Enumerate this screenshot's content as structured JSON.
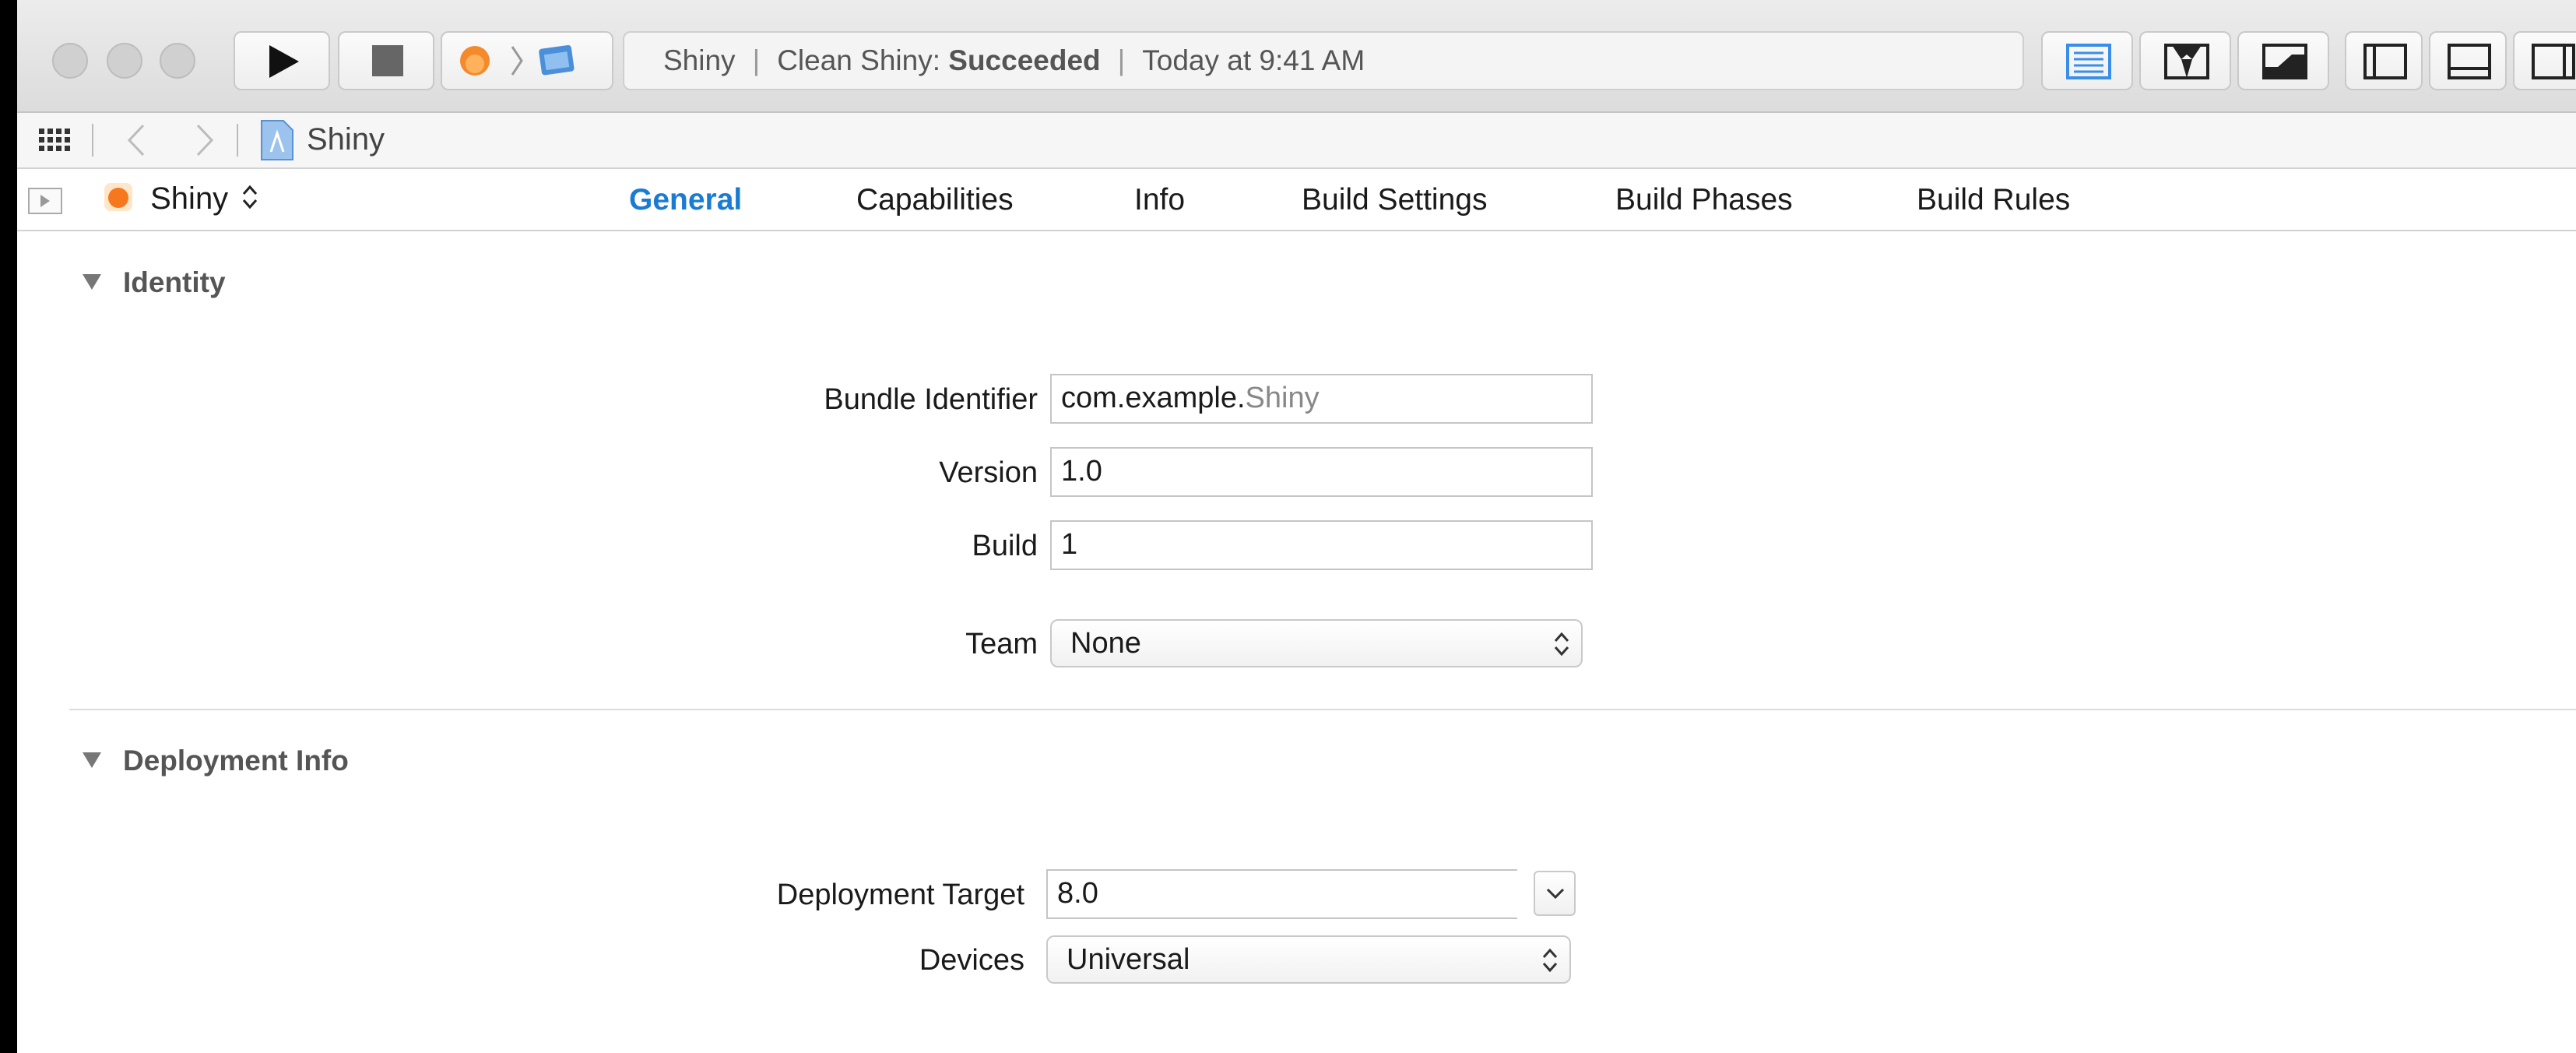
{
  "toolbar": {
    "activity": {
      "scheme": "Shiny",
      "action": "Clean Shiny:",
      "status": "Succeeded",
      "time": "Today at 9:41 AM"
    }
  },
  "jumpbar": {
    "breadcrumb": "Shiny"
  },
  "tabbar": {
    "target": "Shiny",
    "tabs": [
      "General",
      "Capabilities",
      "Info",
      "Build Settings",
      "Build Phases",
      "Build Rules"
    ],
    "active_tab": "General"
  },
  "identity": {
    "title": "Identity",
    "bundle_identifier_label": "Bundle Identifier",
    "bundle_identifier_prefix": "com.example.",
    "bundle_identifier_name": "Shiny",
    "version_label": "Version",
    "version_value": "1.0",
    "build_label": "Build",
    "build_value": "1",
    "team_label": "Team",
    "team_value": "None"
  },
  "deployment": {
    "title": "Deployment Info",
    "target_label": "Deployment Target",
    "target_value": "8.0",
    "devices_label": "Devices",
    "devices_value": "Universal"
  },
  "colors": {
    "accent": "#1a7bd3",
    "selected_view_button": "#3b8ee8"
  }
}
